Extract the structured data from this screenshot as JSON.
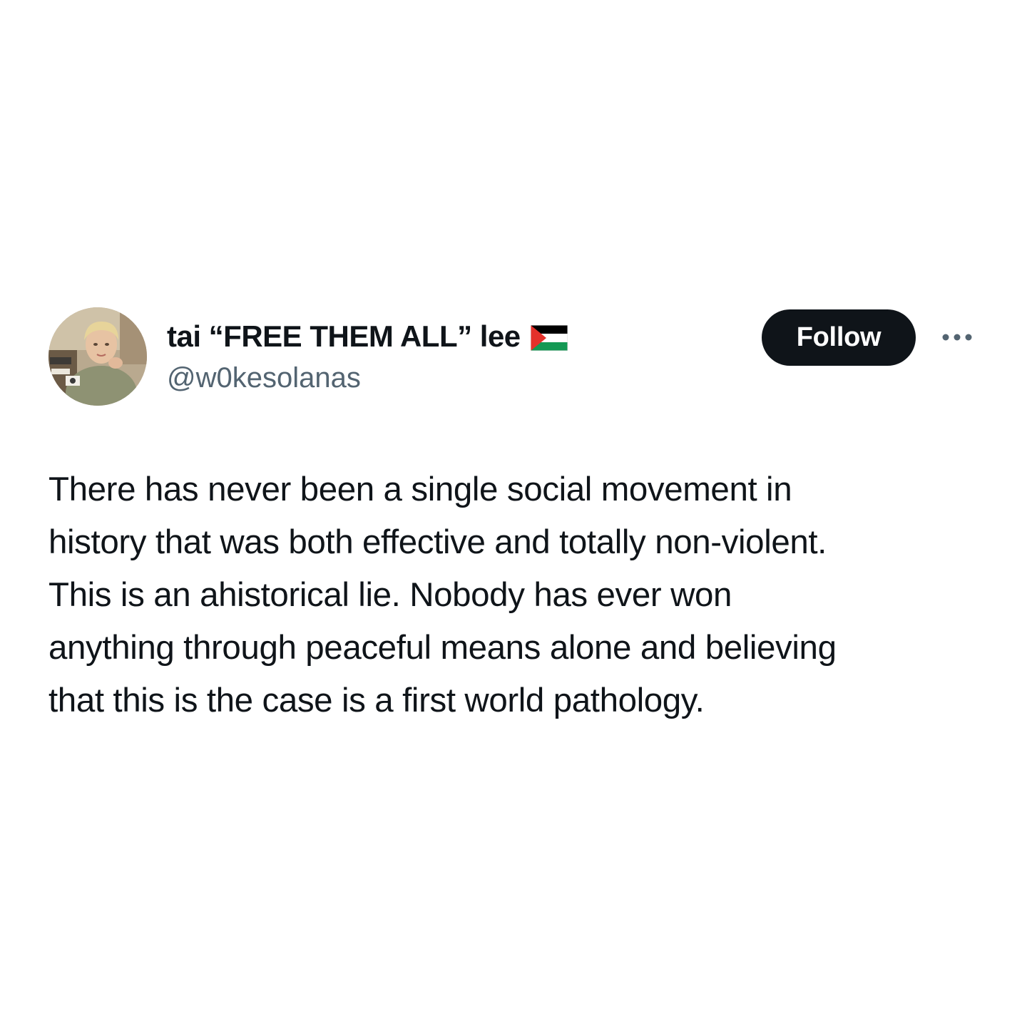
{
  "tweet": {
    "author": {
      "display_name": "tai “FREE THEM ALL” lee",
      "flag_icon": "palestine-flag-icon",
      "handle": "@w0kesolanas",
      "avatar_icon": "profile-photo"
    },
    "follow_label": "Follow",
    "more_icon": "more-options-icon",
    "text_lines": [
      "There has never been a single social movement in",
      "history that was both effective and totally non-violent.",
      "This is an ahistorical lie. Nobody has ever won",
      "anything through peaceful means alone and believing",
      "that this is the case is a first world pathology."
    ]
  },
  "colors": {
    "background": "#ffffff",
    "text_primary": "#0f1419",
    "text_secondary": "#536471",
    "button_bg": "#0f1419",
    "button_text": "#ffffff",
    "flag_black": "#000000",
    "flag_white": "#ffffff",
    "flag_green": "#149954",
    "flag_red": "#e4312b"
  }
}
